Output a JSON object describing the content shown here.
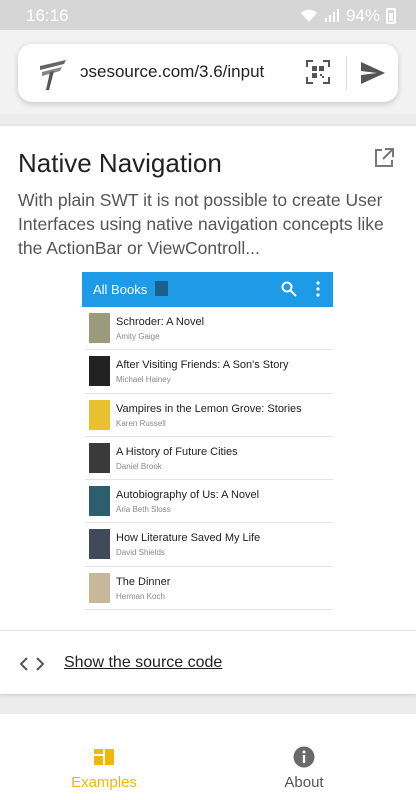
{
  "status": {
    "time": "16:16",
    "battery": "94%"
  },
  "urlbar": {
    "url": "ɔsesource.com/3.6/input"
  },
  "card": {
    "title": "Native Navigation",
    "description": "With plain SWT it is not possible to create User Interfaces using native navigation concepts like the ActionBar or ViewControll...",
    "source_link": "Show the source code"
  },
  "phone": {
    "title": "All Books",
    "books": [
      {
        "title": "Schroder: A Novel",
        "author": "Amity Gaige",
        "cover": "#9a9a7c"
      },
      {
        "title": "After Visiting Friends: A Son's Story",
        "author": "Michael Hainey",
        "cover": "#222222"
      },
      {
        "title": "Vampires in the Lemon Grove: Stories",
        "author": "Karen Russell",
        "cover": "#e8c030"
      },
      {
        "title": "A History of Future Cities",
        "author": "Daniel Brook",
        "cover": "#3a3a3a"
      },
      {
        "title": "Autobiography of Us: A Novel",
        "author": "Aria Beth Sloss",
        "cover": "#2c5e6e"
      },
      {
        "title": "How Literature Saved My Life",
        "author": "David Shields",
        "cover": "#404a58"
      },
      {
        "title": "The Dinner",
        "author": "Herman Koch",
        "cover": "#c8b89a"
      }
    ]
  },
  "nav": {
    "examples": "Examples",
    "about": "About",
    "active_color": "#f2b705",
    "inactive_color": "#555555"
  }
}
